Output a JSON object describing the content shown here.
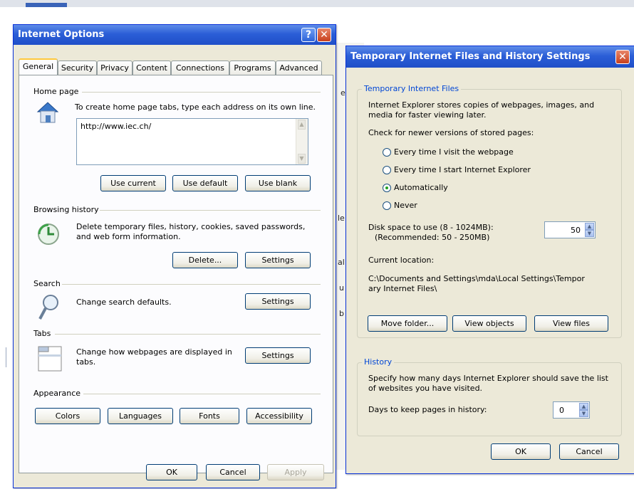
{
  "background": {
    "fragments": [
      {
        "id": "er",
        "text": "er"
      },
      {
        "id": "le",
        "text": "le"
      },
      {
        "id": "al",
        "text": "al"
      },
      {
        "id": "u",
        "text": "u"
      },
      {
        "id": "b",
        "text": "b"
      }
    ]
  },
  "internet_options": {
    "title": "Internet Options",
    "help_glyph": "?",
    "close_glyph": "✕",
    "tabs": [
      "General",
      "Security",
      "Privacy",
      "Content",
      "Connections",
      "Programs",
      "Advanced"
    ],
    "home_page": {
      "label": "Home page",
      "description": "To create home page tabs, type each address on its own line.",
      "url": "http://www.iec.ch/",
      "buttons": {
        "use_current": "Use current",
        "use_default": "Use default",
        "use_blank": "Use blank"
      }
    },
    "browsing_history": {
      "label": "Browsing history",
      "description": "Delete temporary files, history, cookies, saved passwords, and web form information.",
      "delete_button": "Delete...",
      "settings_button": "Settings"
    },
    "search": {
      "label": "Search",
      "description": "Change search defaults.",
      "settings_button": "Settings"
    },
    "tabs_section": {
      "label": "Tabs",
      "description": "Change how webpages are displayed in tabs.",
      "settings_button": "Settings"
    },
    "appearance": {
      "label": "Appearance",
      "buttons": {
        "colors": "Colors",
        "languages": "Languages",
        "fonts": "Fonts",
        "accessibility": "Accessibility"
      }
    },
    "footer": {
      "ok": "OK",
      "cancel": "Cancel",
      "apply": "Apply"
    }
  },
  "tif_dialog": {
    "title": "Temporary Internet Files and History Settings",
    "close_glyph": "✕",
    "temp_files": {
      "label": "Temporary Internet Files",
      "description": "Internet Explorer stores copies of webpages, images, and media for faster viewing later.",
      "check_label": "Check for newer versions of stored pages:",
      "options": [
        "Every time I visit the webpage",
        "Every time I start Internet Explorer",
        "Automatically",
        "Never"
      ],
      "selected_option": "Automatically",
      "disk_space_label": "Disk space to use (8 - 1024MB):",
      "disk_space_recommended": "(Recommended: 50 - 250MB)",
      "disk_space_value": "50",
      "current_location_label": "Current location:",
      "current_location_path": "C:\\Documents and Settings\\mda\\Local Settings\\Temporary Internet Files\\",
      "buttons": {
        "move_folder": "Move folder...",
        "view_objects": "View objects",
        "view_files": "View files"
      }
    },
    "history": {
      "label": "History",
      "description": "Specify how many days Internet Explorer should save the list of websites you have visited.",
      "days_label": "Days to keep pages in history:",
      "days_value": "0"
    },
    "footer": {
      "ok": "OK",
      "cancel": "Cancel"
    }
  }
}
